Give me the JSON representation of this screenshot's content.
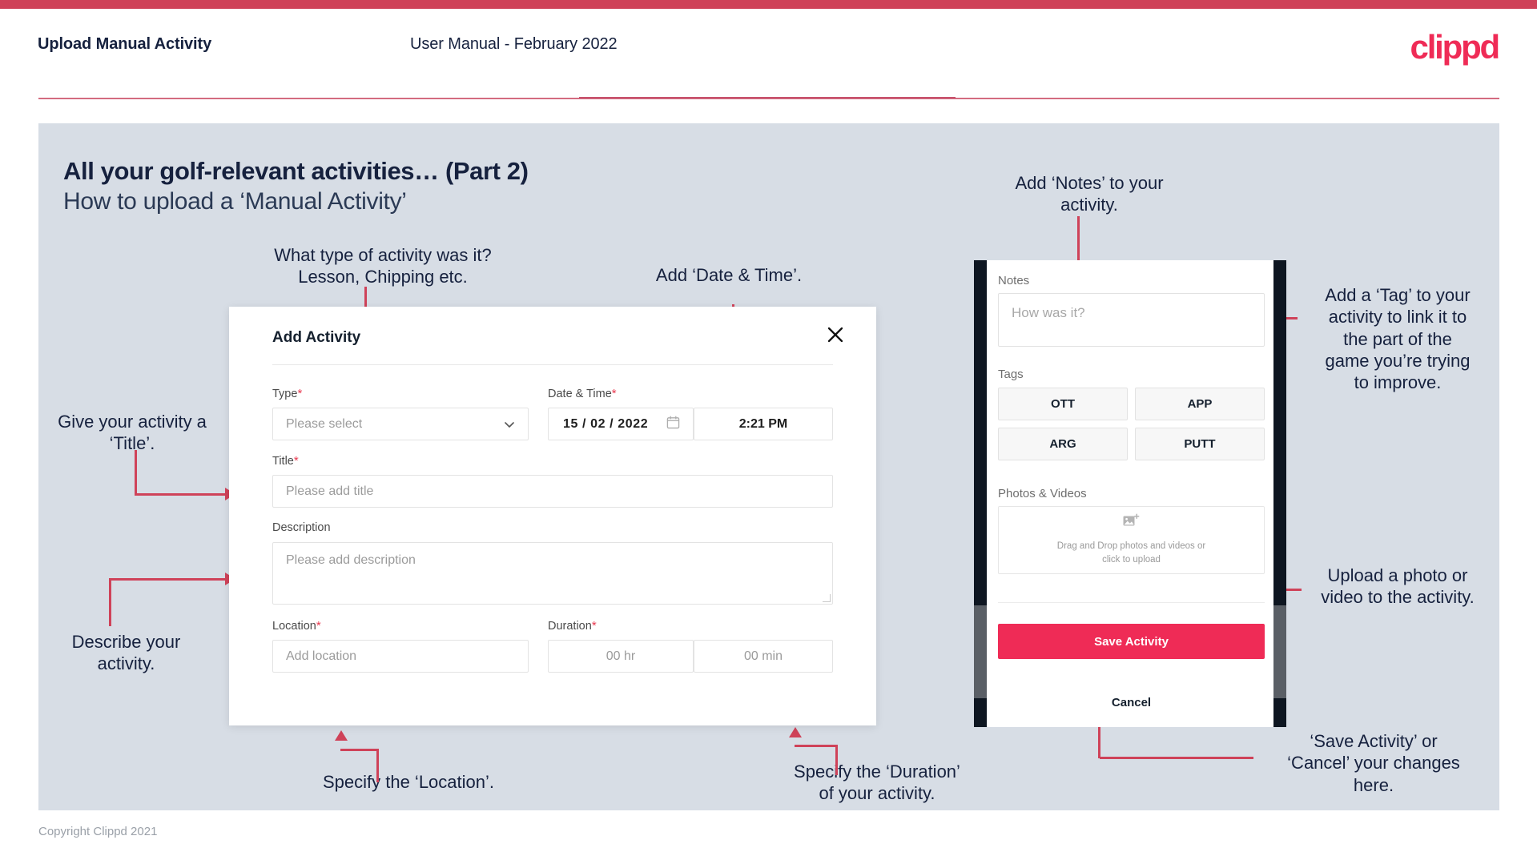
{
  "header": {
    "title": "Upload Manual Activity",
    "subtitle": "User Manual - February 2022",
    "logo": "clippd"
  },
  "slide": {
    "title": "All your golf-relevant activities… (Part 2)",
    "subtitle": "How to upload a ‘Manual Activity’"
  },
  "annotations": {
    "type": "What type of activity was it?\nLesson, Chipping etc.",
    "datetime": "Add ‘Date & Time’.",
    "notes": "Add ‘Notes’ to your\nactivity.",
    "tag": "Add a ‘Tag’ to your\nactivity to link it to\nthe part of the\ngame you’re trying\nto improve.",
    "title_field": "Give your activity a\n‘Title’.",
    "description_field": "Describe your\nactivity.",
    "location_field": "Specify the ‘Location’.",
    "duration_field": "Specify the ‘Duration’\nof your activity.",
    "upload": "Upload a photo or\nvideo to the activity.",
    "save_cancel": "‘Save Activity’ or\n‘Cancel’ your changes\nhere."
  },
  "dialog": {
    "title": "Add Activity",
    "close_icon": "close-icon",
    "fields": {
      "type": {
        "label": "Type",
        "required": "*",
        "placeholder": "Please select",
        "value": ""
      },
      "datetime": {
        "label": "Date & Time",
        "required": "*",
        "date": "15 / 02 / 2022",
        "day": "15",
        "month": "02",
        "year": "2022",
        "time": "2:21 PM"
      },
      "title": {
        "label": "Title",
        "required": "*",
        "placeholder": "Please add title",
        "value": ""
      },
      "description": {
        "label": "Description",
        "required": "",
        "placeholder": "Please add description",
        "value": ""
      },
      "location": {
        "label": "Location",
        "required": "*",
        "placeholder": "Add location",
        "value": ""
      },
      "duration": {
        "label": "Duration",
        "required": "*",
        "hours_placeholder": "00 hr",
        "minutes_placeholder": "00 min"
      }
    }
  },
  "phone": {
    "notes": {
      "label": "Notes",
      "placeholder": "How was it?"
    },
    "tags": {
      "label": "Tags",
      "items": [
        "OTT",
        "APP",
        "ARG",
        "PUTT"
      ]
    },
    "photos": {
      "label": "Photos & Videos",
      "drop_line1": "Drag and Drop photos and videos or",
      "drop_line2": "click to upload",
      "icon": "image-add-icon"
    },
    "save_label": "Save Activity",
    "cancel_label": "Cancel"
  },
  "footer": {
    "copyright": "Copyright Clippd 2021"
  },
  "colors": {
    "accent": "#ef2b56",
    "rule": "#cf4259",
    "slide_bg": "#d7dde5",
    "text_dark": "#16213e"
  }
}
